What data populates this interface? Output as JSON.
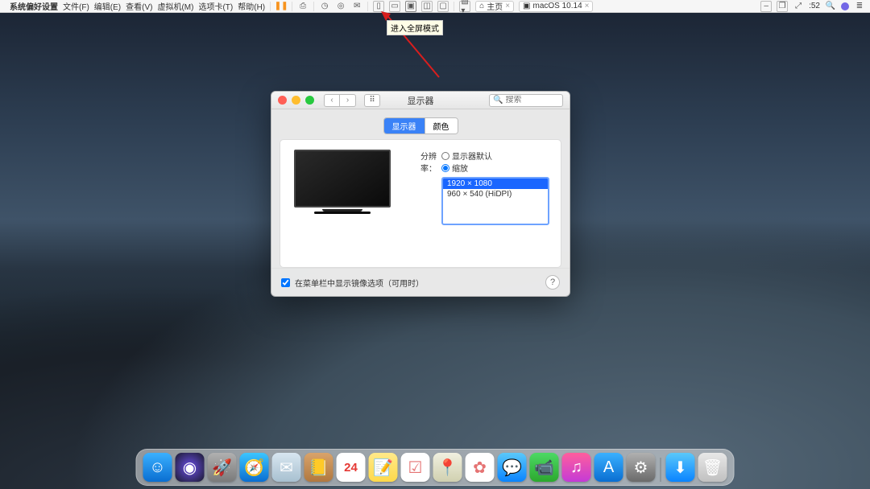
{
  "host_menu": {
    "apple": "",
    "app_name": "系统偏好设置",
    "items": [
      "文件(F)",
      "编辑(E)",
      "查看(V)",
      "虚拟机(M)",
      "选项卡(T)",
      "帮助(H)"
    ],
    "tab_home": "主页",
    "tab_os": "macOS 10.14",
    "clock": ":52",
    "pause_glyph": "❚❚"
  },
  "tooltip": "进入全屏模式",
  "window": {
    "title": "显示器",
    "search_placeholder": "搜索",
    "tabs": {
      "display": "显示器",
      "color": "颜色"
    },
    "resolution_label": "分辨率：",
    "radio_default": "显示器默认",
    "radio_scaled": "缩放",
    "resolutions": [
      {
        "label": "1920 × 1080",
        "selected": true
      },
      {
        "label": "960 × 540 (HiDPI)",
        "selected": false
      }
    ],
    "footer_checkbox": "在菜单栏中显示镜像选项（可用时）",
    "help": "?"
  },
  "dock_icons": [
    {
      "name": "finder",
      "bg": "linear-gradient(#3ab0ff,#0a6ed1)",
      "glyph": "☺"
    },
    {
      "name": "siri",
      "bg": "radial-gradient(circle,#6b4fe6,#1a1a2e)",
      "glyph": "◉"
    },
    {
      "name": "launchpad",
      "bg": "linear-gradient(#b0b0b0,#7a7a7a)",
      "glyph": "🚀"
    },
    {
      "name": "safari",
      "bg": "linear-gradient(#3cc5ff,#0a6ed1)",
      "glyph": "🧭"
    },
    {
      "name": "mail",
      "bg": "linear-gradient(#d8e6f0,#a8c0d0)",
      "glyph": "✉"
    },
    {
      "name": "contacts",
      "bg": "linear-gradient(#d9a36a,#b07840)",
      "glyph": "📒"
    },
    {
      "name": "calendar",
      "bg": "#fff",
      "glyph": "24"
    },
    {
      "name": "notes",
      "bg": "linear-gradient(#ffe98a,#ffd94a)",
      "glyph": "📝"
    },
    {
      "name": "reminders",
      "bg": "#fff",
      "glyph": "☑"
    },
    {
      "name": "maps",
      "bg": "linear-gradient(#f0f0e0,#d0d0b0)",
      "glyph": "📍"
    },
    {
      "name": "photos",
      "bg": "#fff",
      "glyph": "✿"
    },
    {
      "name": "messages",
      "bg": "linear-gradient(#5ac8fa,#0a84ff)",
      "glyph": "💬"
    },
    {
      "name": "facetime",
      "bg": "linear-gradient(#4cd964,#2ca82e)",
      "glyph": "📹"
    },
    {
      "name": "itunes",
      "bg": "linear-gradient(#ff5e9c,#c43bd7)",
      "glyph": "♫"
    },
    {
      "name": "appstore",
      "bg": "linear-gradient(#3ab0ff,#0a6ed1)",
      "glyph": "A"
    },
    {
      "name": "sysprefs",
      "bg": "linear-gradient(#b0b0b0,#6a6a6a)",
      "glyph": "⚙"
    },
    {
      "name": "downloads",
      "bg": "linear-gradient(#5ac8fa,#0a84ff)",
      "glyph": "⬇"
    },
    {
      "name": "trash",
      "bg": "linear-gradient(#e8e8e8,#c0c0c0)",
      "glyph": "🗑"
    }
  ]
}
